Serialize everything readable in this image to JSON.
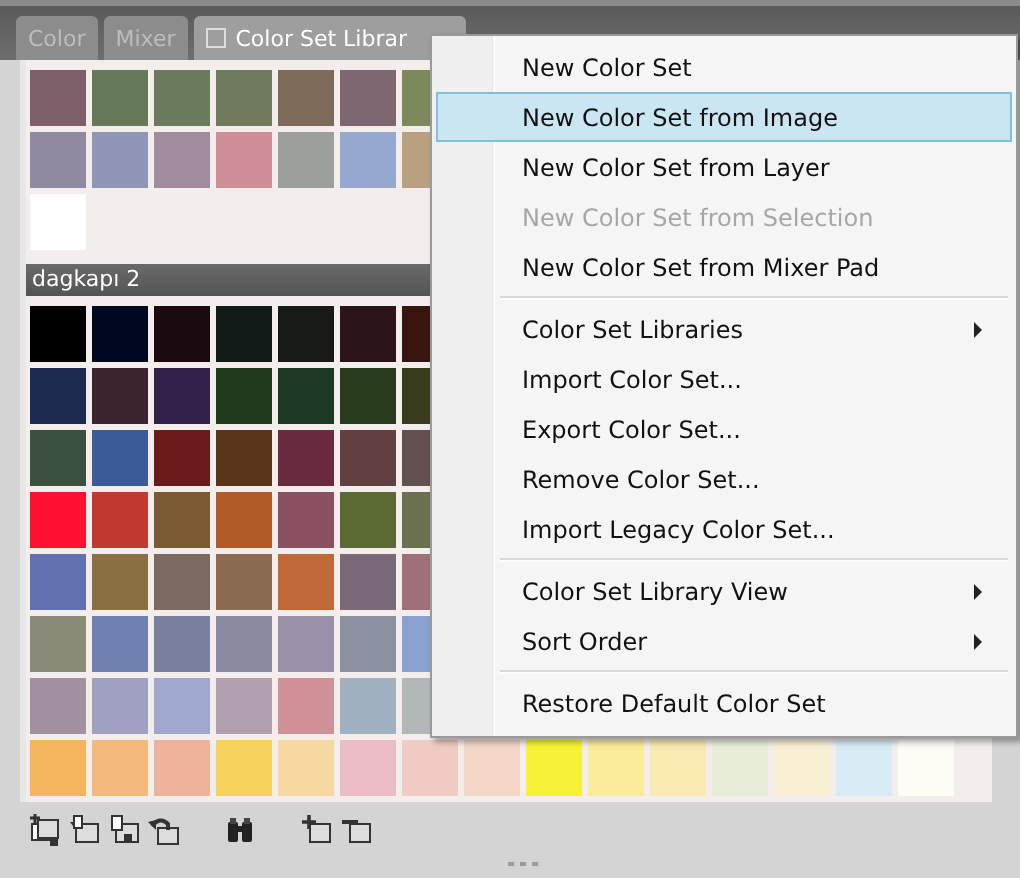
{
  "tabs": [
    {
      "label": "Color",
      "selected": false
    },
    {
      "label": "Mixer",
      "selected": false
    },
    {
      "label": "Color Set Librar",
      "selected": true
    }
  ],
  "color_sets": [
    {
      "rows": [
        [
          {
            "color": "#7d5f6a"
          },
          {
            "color": "#667a57"
          },
          {
            "color": "#6a7a5c"
          },
          {
            "color": "#6f7a5c"
          },
          {
            "color": "#7d6a58"
          },
          {
            "color": "#7c6670"
          },
          {
            "color": "#7a8a5a"
          }
        ],
        [
          {
            "color": "#8f8aa2"
          },
          {
            "color": "#8f96b8"
          },
          {
            "color": "#a08c9c"
          },
          {
            "color": "#d08e98"
          },
          {
            "color": "#9ba09a"
          },
          {
            "color": "#96a8cf"
          },
          {
            "color": "#b8a080"
          }
        ],
        [
          {
            "color": "#ffffff"
          }
        ]
      ]
    },
    {
      "name": "dagkapı 2",
      "rows": [
        [
          {
            "color": "#000000"
          },
          {
            "color": "#000820"
          },
          {
            "color": "#1a0a10"
          },
          {
            "color": "#101a16"
          },
          {
            "color": "#181a18"
          },
          {
            "color": "#2a1418"
          },
          {
            "color": "#3a1410"
          }
        ],
        [
          {
            "color": "#1c2a50"
          },
          {
            "color": "#3a2430"
          },
          {
            "color": "#30204a"
          },
          {
            "color": "#203a1c"
          },
          {
            "color": "#1e3a24"
          },
          {
            "color": "#283a1c"
          },
          {
            "color": "#3a3a1c"
          }
        ],
        [
          {
            "color": "#3c5040"
          },
          {
            "color": "#3a5a98"
          },
          {
            "color": "#6a1a18"
          },
          {
            "color": "#5a3418"
          },
          {
            "color": "#6a2a40"
          },
          {
            "color": "#604040"
          },
          {
            "color": "#605050"
          }
        ],
        [
          {
            "color": "#ff1030"
          },
          {
            "color": "#c03830"
          },
          {
            "color": "#7a5a30"
          },
          {
            "color": "#b05a28"
          },
          {
            "color": "#8a5060"
          },
          {
            "color": "#5a6a30"
          },
          {
            "color": "#6a7050"
          }
        ],
        [
          {
            "color": "#6070b0"
          },
          {
            "color": "#8a7040"
          },
          {
            "color": "#7a6a60"
          },
          {
            "color": "#8a6a50"
          },
          {
            "color": "#c06838"
          },
          {
            "color": "#7a6a78"
          },
          {
            "color": "#a07078"
          }
        ],
        [
          {
            "color": "#8a8a78"
          },
          {
            "color": "#7080b0"
          },
          {
            "color": "#7a80a0"
          },
          {
            "color": "#8a8aa0"
          },
          {
            "color": "#9a90a8"
          },
          {
            "color": "#8a90a0"
          },
          {
            "color": "#8aa0d0"
          }
        ],
        [
          {
            "color": "#a090a0"
          },
          {
            "color": "#a0a0c0"
          },
          {
            "color": "#a0a8d0"
          },
          {
            "color": "#b0a0b0"
          },
          {
            "color": "#d09098"
          },
          {
            "color": "#a0b0c0"
          },
          {
            "color": "#b0b8b8"
          }
        ],
        [
          {
            "color": "#f4b55e"
          },
          {
            "color": "#f3b97a"
          },
          {
            "color": "#efb39c"
          },
          {
            "color": "#f5d35c"
          },
          {
            "color": "#f6d9a0"
          },
          {
            "color": "#ecbcc6"
          },
          {
            "color": "#efcbc3"
          },
          {
            "color": "#f3d6c7"
          },
          {
            "color": "#f8f237"
          },
          {
            "color": "#f9ec9a"
          },
          {
            "color": "#f8eab0"
          },
          {
            "color": "#e6edd8"
          },
          {
            "color": "#f9f0d4"
          },
          {
            "color": "#d8ecf6"
          },
          {
            "color": "#fdfdf5"
          }
        ]
      ]
    }
  ],
  "menu": [
    {
      "kind": "item",
      "label": "New Color Set",
      "selected": false,
      "disabled": false,
      "submenu": false
    },
    {
      "kind": "item",
      "label": "New Color Set from Image",
      "selected": true,
      "disabled": false,
      "submenu": false
    },
    {
      "kind": "item",
      "label": "New Color Set from Layer",
      "selected": false,
      "disabled": false,
      "submenu": false
    },
    {
      "kind": "item",
      "label": "New Color Set from Selection",
      "selected": false,
      "disabled": true,
      "submenu": false
    },
    {
      "kind": "item",
      "label": "New Color Set from Mixer Pad",
      "selected": false,
      "disabled": false,
      "submenu": false
    },
    {
      "kind": "separator"
    },
    {
      "kind": "item",
      "label": "Color Set Libraries",
      "selected": false,
      "disabled": false,
      "submenu": true
    },
    {
      "kind": "item",
      "label": "Import Color Set...",
      "selected": false,
      "disabled": false,
      "submenu": false
    },
    {
      "kind": "item",
      "label": "Export Color Set...",
      "selected": false,
      "disabled": false,
      "submenu": false
    },
    {
      "kind": "item",
      "label": "Remove Color Set...",
      "selected": false,
      "disabled": false,
      "submenu": false
    },
    {
      "kind": "item",
      "label": "Import Legacy Color Set...",
      "selected": false,
      "disabled": false,
      "submenu": false
    },
    {
      "kind": "separator"
    },
    {
      "kind": "item",
      "label": "Color Set Library View",
      "selected": false,
      "disabled": false,
      "submenu": true
    },
    {
      "kind": "item",
      "label": "Sort Order",
      "selected": false,
      "disabled": false,
      "submenu": true
    },
    {
      "kind": "separator"
    },
    {
      "kind": "item",
      "label": "Restore Default Color Set",
      "selected": false,
      "disabled": false,
      "submenu": false
    }
  ],
  "toolbar": [
    {
      "kind": "add-set"
    },
    {
      "kind": "open-set"
    },
    {
      "kind": "save-set"
    },
    {
      "kind": "revert-set"
    },
    {
      "kind": "find"
    },
    {
      "kind": "add-swatch"
    },
    {
      "kind": "remove-swatch"
    }
  ]
}
